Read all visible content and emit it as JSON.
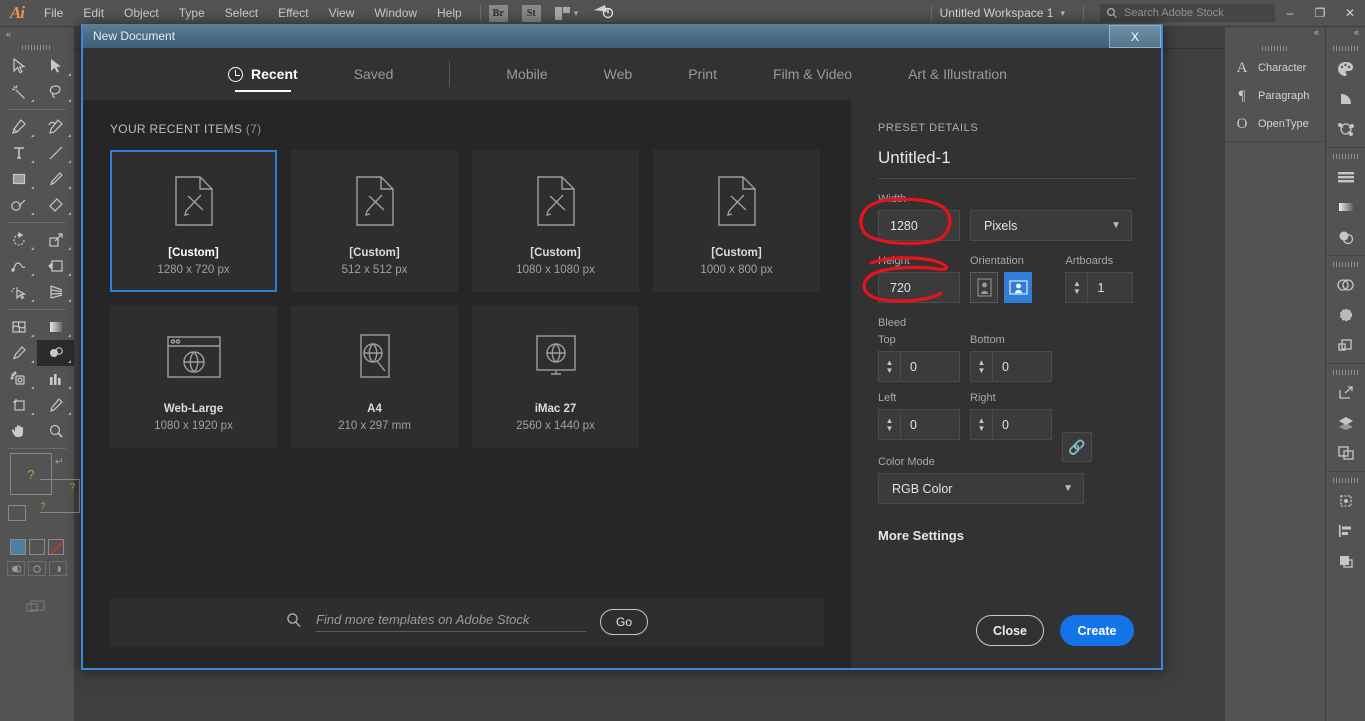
{
  "menubar": {
    "logo": "Ai",
    "items": [
      "File",
      "Edit",
      "Object",
      "Type",
      "Select",
      "Effect",
      "View",
      "Window",
      "Help"
    ],
    "app_buttons": [
      "Br",
      "St"
    ],
    "workspace": "Untitled Workspace 1",
    "stock_search_placeholder": "Search Adobe Stock",
    "window_controls": [
      "–",
      "❐",
      "✕"
    ]
  },
  "dialog": {
    "title": "New Document",
    "close_glyph": "X",
    "tabs": [
      {
        "label": "Recent",
        "icon": "clock-icon",
        "active": true
      },
      {
        "label": "Saved",
        "icon": "",
        "active": false
      },
      {
        "label": "Mobile",
        "icon": "",
        "active": false
      },
      {
        "label": "Web",
        "icon": "",
        "active": false
      },
      {
        "label": "Print",
        "icon": "",
        "active": false
      },
      {
        "label": "Film & Video",
        "icon": "",
        "active": false
      },
      {
        "label": "Art & Illustration",
        "icon": "",
        "active": false
      }
    ],
    "recent": {
      "heading": "YOUR RECENT ITEMS",
      "count": "(7)",
      "items": [
        {
          "name": "[Custom]",
          "dimensions": "1280 x 720 px",
          "thumb": "document-icon",
          "selected": true
        },
        {
          "name": "[Custom]",
          "dimensions": "512 x 512 px",
          "thumb": "document-icon",
          "selected": false
        },
        {
          "name": "[Custom]",
          "dimensions": "1080 x 1080 px",
          "thumb": "document-icon",
          "selected": false
        },
        {
          "name": "[Custom]",
          "dimensions": "1000 x 800 px",
          "thumb": "document-icon",
          "selected": false
        },
        {
          "name": "Web-Large",
          "dimensions": "1080 x 1920 px",
          "thumb": "browser-icon",
          "selected": false
        },
        {
          "name": "A4",
          "dimensions": "210 x 297 mm",
          "thumb": "print-icon",
          "selected": false
        },
        {
          "name": "iMac 27",
          "dimensions": "2560 x 1440 px",
          "thumb": "monitor-icon",
          "selected": false
        }
      ]
    },
    "stock": {
      "placeholder": "Find more templates on Adobe Stock",
      "go_label": "Go",
      "search_icon": "search-icon"
    },
    "preset": {
      "heading": "PRESET DETAILS",
      "document_name": "Untitled-1",
      "width_label": "Width",
      "width_value": "1280",
      "units_value": "Pixels",
      "height_label": "Height",
      "height_value": "720",
      "orientation_label": "Orientation",
      "artboards_label": "Artboards",
      "artboards_value": "1",
      "bleed_label": "Bleed",
      "bleed_top_label": "Top",
      "bleed_top_value": "0",
      "bleed_bottom_label": "Bottom",
      "bleed_bottom_value": "0",
      "bleed_left_label": "Left",
      "bleed_left_value": "0",
      "bleed_right_label": "Right",
      "bleed_right_value": "0",
      "link_icon": "link-icon",
      "color_mode_label": "Color Mode",
      "color_mode_value": "RGB Color",
      "more_settings": "More Settings"
    },
    "actions": {
      "close_label": "Close",
      "create_label": "Create"
    }
  },
  "right_panels": {
    "type_items": [
      {
        "glyph": "A",
        "label": "Character"
      },
      {
        "glyph": "¶",
        "label": "Paragraph"
      },
      {
        "glyph": "O",
        "label": "OpenType"
      }
    ]
  },
  "colors": {
    "accent_blue": "#1473e6",
    "selection_blue": "#2f7fd8",
    "annotation_red": "#e8131a",
    "dialog_bg": "#323232",
    "panel_bg": "#535353",
    "content_bg": "#262626"
  }
}
